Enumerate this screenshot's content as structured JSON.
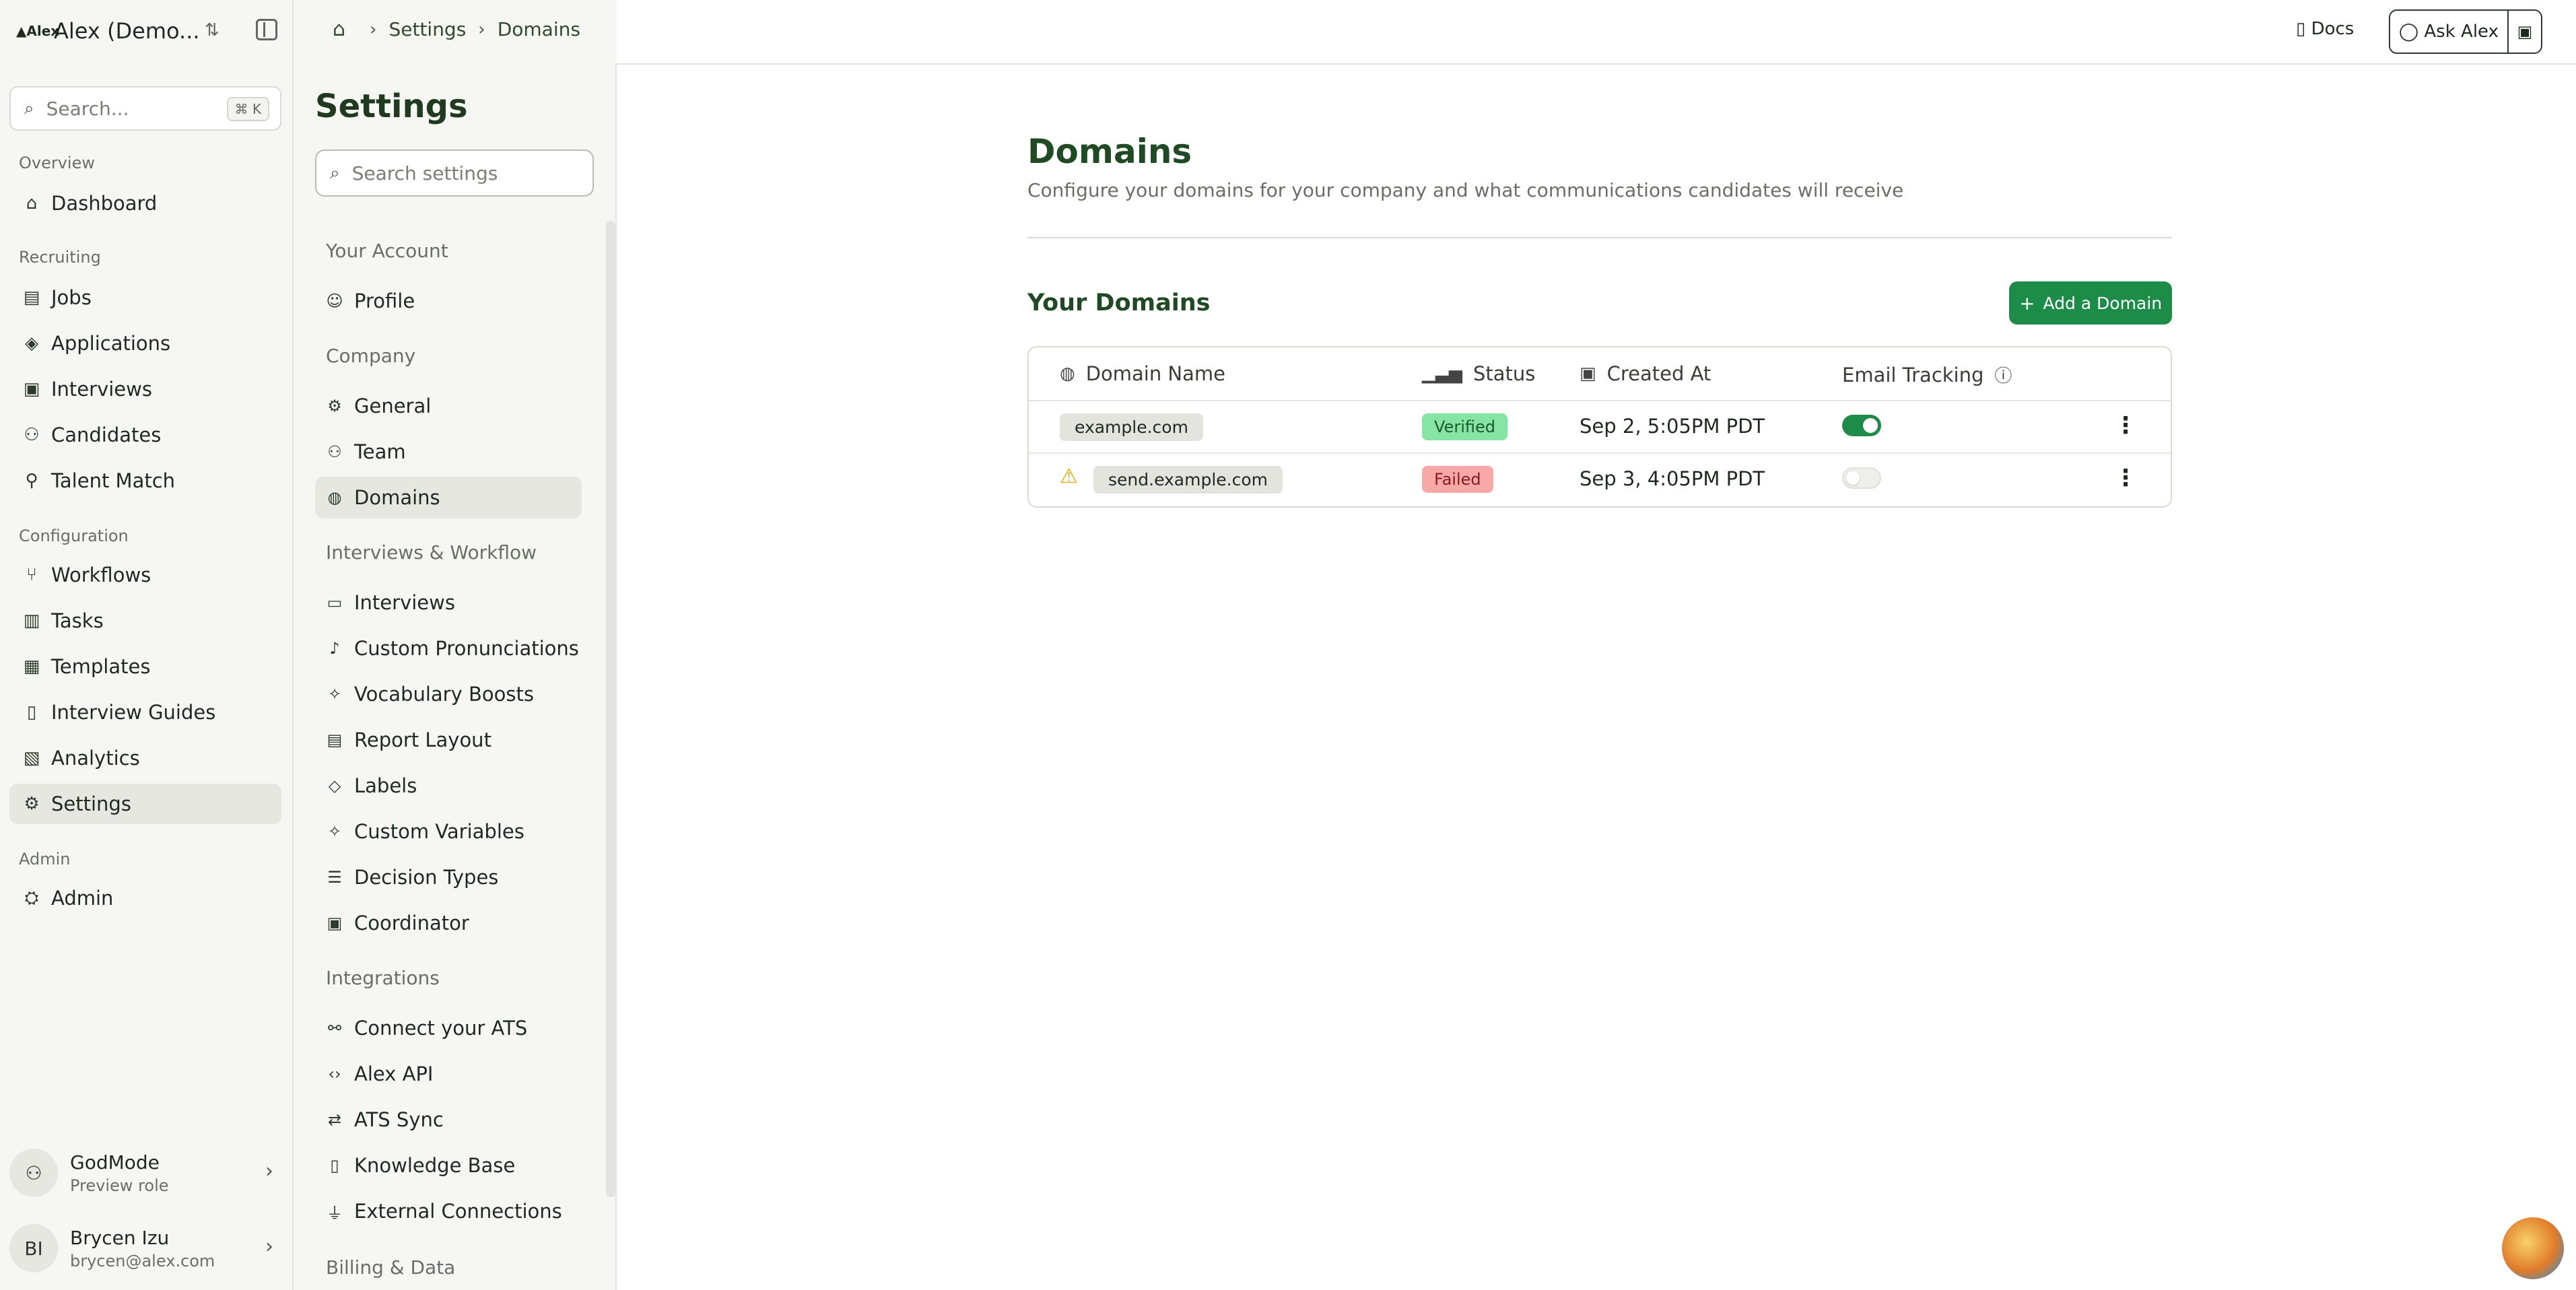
{
  "brand": {
    "logo": "▲Alex",
    "name": "Alex (Demo..."
  },
  "global_search": {
    "placeholder": "Search...",
    "shortcut": "⌘ K"
  },
  "nav": {
    "overview_label": "Overview",
    "recruiting_label": "Recruiting",
    "configuration_label": "Configuration",
    "admin_label": "Admin",
    "items": [
      {
        "label": "Dashboard",
        "icon": "home-icon"
      },
      {
        "label": "Jobs",
        "icon": "briefcase-icon"
      },
      {
        "label": "Applications",
        "icon": "layers-icon"
      },
      {
        "label": "Interviews",
        "icon": "calendar-icon"
      },
      {
        "label": "Candidates",
        "icon": "users-icon"
      },
      {
        "label": "Talent Match",
        "icon": "user-search-icon"
      },
      {
        "label": "Workflows",
        "icon": "workflow-icon"
      },
      {
        "label": "Tasks",
        "icon": "clipboard-icon"
      },
      {
        "label": "Templates",
        "icon": "template-icon"
      },
      {
        "label": "Interview Guides",
        "icon": "book-icon"
      },
      {
        "label": "Analytics",
        "icon": "chart-icon"
      },
      {
        "label": "Settings",
        "icon": "gear-icon"
      },
      {
        "label": "Admin",
        "icon": "admin-icon"
      }
    ]
  },
  "role": {
    "title": "GodMode",
    "subtitle": "Preview role"
  },
  "user": {
    "initials": "BI",
    "name": "Brycen Izu",
    "email": "brycen@alex.com"
  },
  "breadcrumb": {
    "items": [
      "Settings",
      "Domains"
    ]
  },
  "topbar": {
    "docs": "Docs",
    "ask": "Ask Alex"
  },
  "settings": {
    "title": "Settings",
    "search_placeholder": "Search settings",
    "sections": {
      "account": "Your Account",
      "company": "Company",
      "interviews": "Interviews & Workflow",
      "integrations": "Integrations",
      "billing": "Billing & Data"
    },
    "items": [
      {
        "label": "Profile"
      },
      {
        "label": "General"
      },
      {
        "label": "Team"
      },
      {
        "label": "Domains"
      },
      {
        "label": "Interviews"
      },
      {
        "label": "Custom Pronunciations"
      },
      {
        "label": "Vocabulary Boosts"
      },
      {
        "label": "Report Layout"
      },
      {
        "label": "Labels"
      },
      {
        "label": "Custom Variables"
      },
      {
        "label": "Decision Types"
      },
      {
        "label": "Coordinator"
      },
      {
        "label": "Connect your ATS"
      },
      {
        "label": "Alex API"
      },
      {
        "label": "ATS Sync"
      },
      {
        "label": "Knowledge Base"
      },
      {
        "label": "External Connections"
      }
    ]
  },
  "main": {
    "title": "Domains",
    "description": "Configure your domains for your company and what communications candidates will receive",
    "section_title": "Your Domains",
    "add_button": "Add a Domain",
    "columns": [
      "Domain Name",
      "Status",
      "Created At",
      "Email Tracking"
    ],
    "rows": [
      {
        "domain": "example.com",
        "status": "Verified",
        "created": "Sep 2, 5:05PM PDT",
        "tracking": true,
        "warning": false
      },
      {
        "domain": "send.example.com",
        "status": "Failed",
        "created": "Sep 3, 4:05PM PDT",
        "tracking": false,
        "warning": true
      }
    ]
  },
  "colors": {
    "accent": "#1c8c48",
    "verified_bg": "#86e4a4",
    "failed_bg": "#f9a8a8"
  }
}
